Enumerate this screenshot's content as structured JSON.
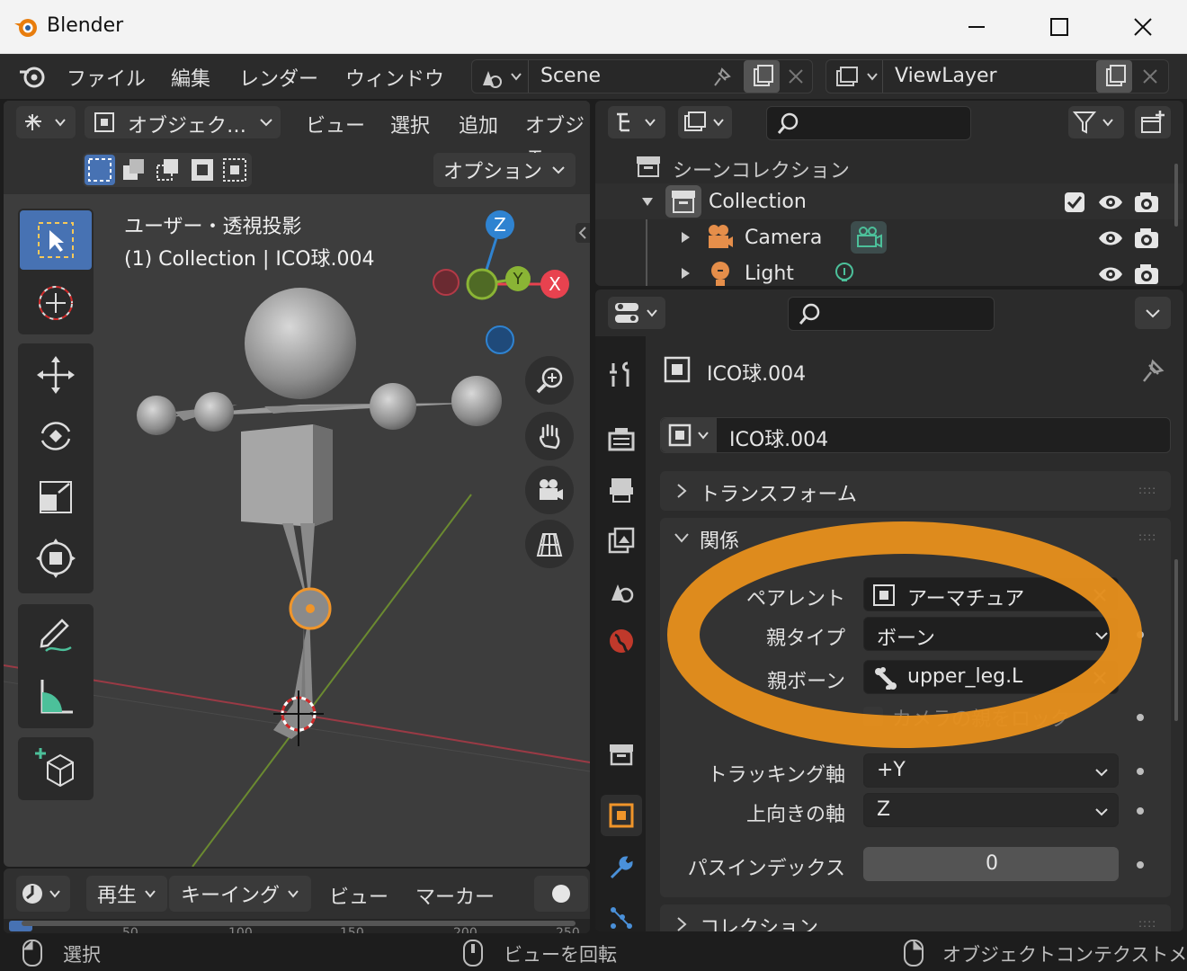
{
  "window": {
    "title": "Blender"
  },
  "menubar": {
    "items": [
      "ファイル",
      "編集",
      "レンダー",
      "ウィンドウ"
    ],
    "scene": "Scene",
    "view_layer": "ViewLayer"
  },
  "viewport": {
    "mode": "オブジェク…",
    "menus": [
      "ビュー",
      "選択",
      "追加",
      "オブジェ"
    ],
    "options_label": "オプション",
    "overlay_line1": "ユーザー・透視投影",
    "overlay_line2": "(1) Collection | ICO球.004",
    "gizmo_axes": {
      "z": "Z",
      "y": "Y",
      "x": "X"
    }
  },
  "timeline": {
    "menus": [
      "再生",
      "キーイング",
      "ビュー",
      "マーカー"
    ],
    "ruler_numbers": [
      "50",
      "100",
      "150",
      "200",
      "250"
    ]
  },
  "outliner": {
    "scene_collection": "シーンコレクション",
    "rows": [
      {
        "label": "Collection"
      },
      {
        "label": "Camera"
      },
      {
        "label": "Light"
      }
    ]
  },
  "properties": {
    "object_name_header": "ICO球.004",
    "object_name_field": "ICO球.004",
    "panels": {
      "transform": "トランスフォーム",
      "relations": "関係",
      "collections": "コレクション"
    },
    "relations": {
      "parent_label": "ペアレント",
      "parent_value": "アーマチュア",
      "parent_type_label": "親タイプ",
      "parent_type_value": "ボーン",
      "parent_bone_label": "親ボーン",
      "parent_bone_value": "upper_leg.L",
      "camera_lock_label": "カメラの親をロック",
      "tracking_axis_label": "トラッキング軸",
      "tracking_axis_value": "+Y",
      "up_axis_label": "上向きの軸",
      "up_axis_value": "Z",
      "pass_index_label": "パスインデックス",
      "pass_index_value": "0"
    }
  },
  "statusbar": {
    "left": "選択",
    "middle": "ビューを回転",
    "right": "オブジェクトコンテクストメ"
  },
  "colors": {
    "highlight_ring": "#e8901c",
    "active_tool": "#4772b3",
    "axis_x": "#e8424f",
    "axis_y": "#8ab435",
    "axis_z": "#2f83d1"
  }
}
